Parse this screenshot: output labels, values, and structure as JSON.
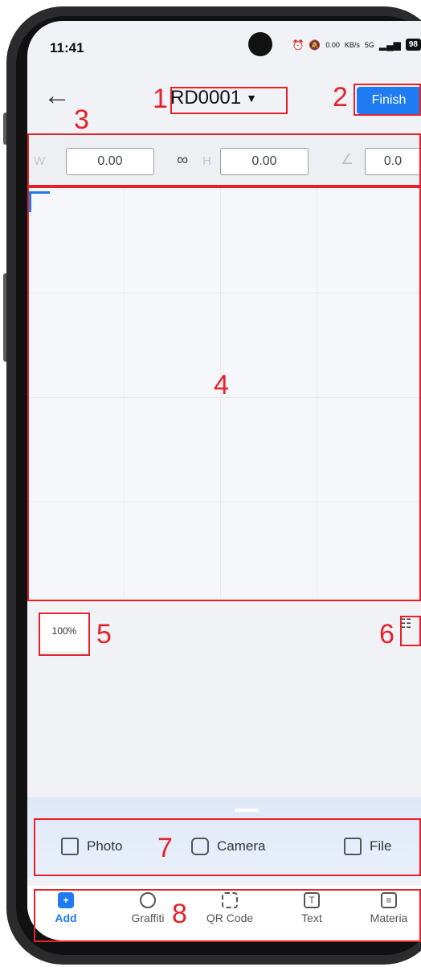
{
  "status": {
    "time": "11:41",
    "speed_value": "0.00",
    "speed_unit": "KB/s",
    "network": "5G",
    "battery": "98"
  },
  "header": {
    "title": "RD0001",
    "finish_label": "Finish"
  },
  "dimensions": {
    "width_label": "W",
    "width_value": "0.00",
    "height_label": "H",
    "height_value": "0.00",
    "angle_value": "0.0"
  },
  "zoom": "100%",
  "sources": [
    {
      "label": "Photo"
    },
    {
      "label": "Camera"
    },
    {
      "label": "File"
    }
  ],
  "nav": [
    {
      "label": "Add"
    },
    {
      "label": "Graffiti"
    },
    {
      "label": "QR Code"
    },
    {
      "label": "Text"
    },
    {
      "label": "Materia"
    }
  ],
  "annotations": [
    "1",
    "2",
    "3",
    "4",
    "5",
    "6",
    "7",
    "8"
  ],
  "colors": {
    "accent": "#1e7bf2",
    "annotation": "#e5222a"
  }
}
